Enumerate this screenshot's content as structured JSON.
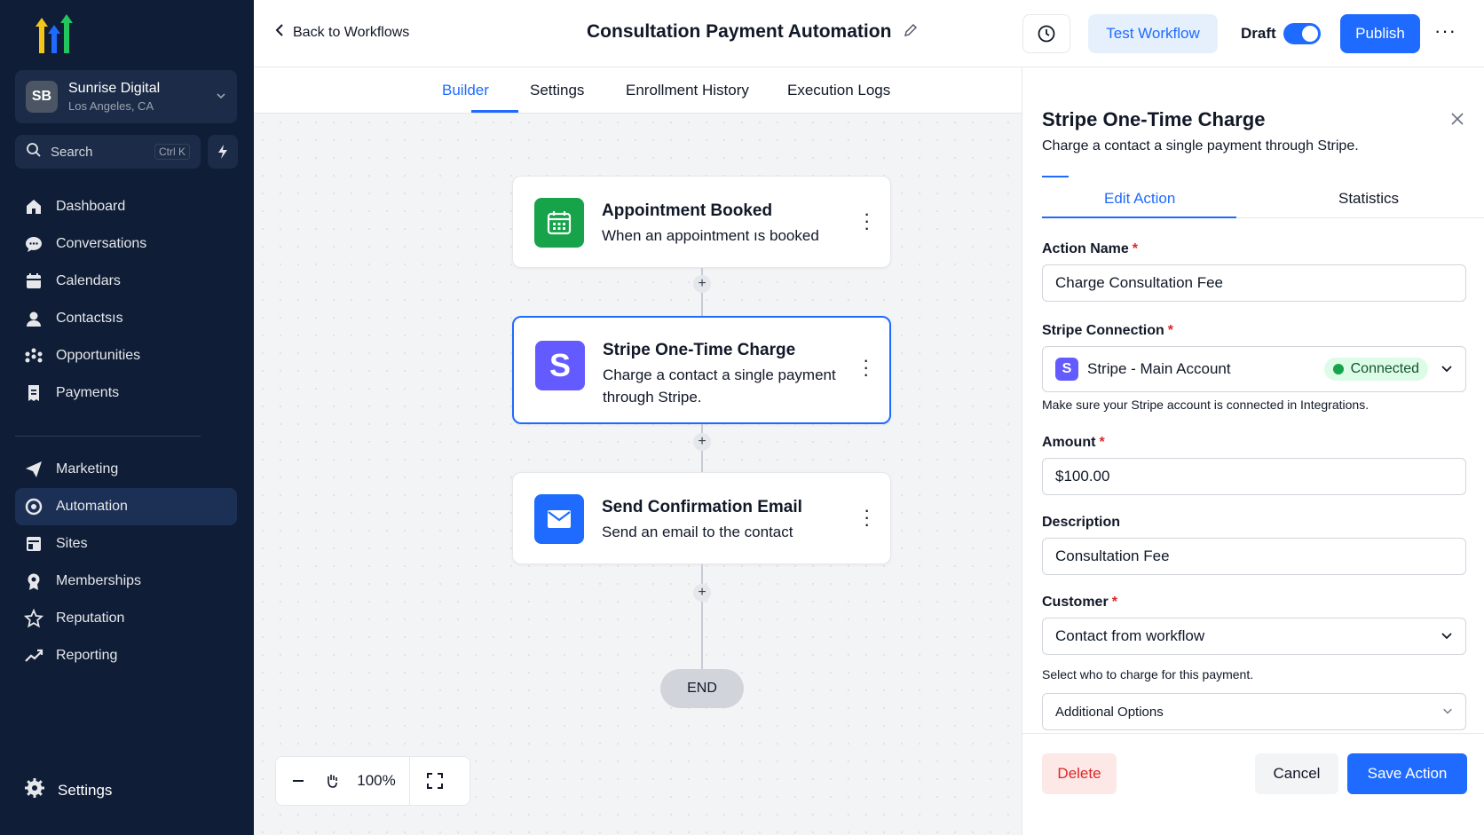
{
  "sidebar": {
    "account": {
      "initials": "SB",
      "name": "Sunrise Digital",
      "location": "Los Angeles, CA"
    },
    "search": {
      "label": "Search",
      "shortcut": "Ctrl K"
    },
    "items": [
      {
        "label": "Dashboard",
        "icon": "home-icon"
      },
      {
        "label": "Conversations",
        "icon": "chat-icon"
      },
      {
        "label": "Calendars",
        "icon": "calendar-icon"
      },
      {
        "label": "Contactsıs",
        "icon": "contacts-icon"
      },
      {
        "label": "Opportunities",
        "icon": "opportunities-icon"
      },
      {
        "label": "Payments",
        "icon": "payments-icon"
      }
    ],
    "items2": [
      {
        "label": "Marketing",
        "icon": "send-icon"
      },
      {
        "label": "Automation",
        "icon": "automation-icon",
        "active": true
      },
      {
        "label": "Sites",
        "icon": "sites-icon"
      },
      {
        "label": "Memberships",
        "icon": "membership-icon"
      },
      {
        "label": "Reputation",
        "icon": "star-icon"
      },
      {
        "label": "Reporting",
        "icon": "chart-icon"
      }
    ],
    "settings_label": "Settings"
  },
  "topbar": {
    "back_label": "Back to Workflows",
    "title": "Consultation Payment Automation",
    "test_label": "Test Workflow",
    "draft_label": "Draft",
    "draft_on": true,
    "publish_label": "Publish"
  },
  "tabs": [
    "Builder",
    "Settings",
    "Enrollment History",
    "Execution Logs"
  ],
  "canvas": {
    "nodes": [
      {
        "title": "Appointment Booked",
        "desc": "When an appointment ıs booked"
      },
      {
        "title": "Stripe One-Time Charge",
        "desc": "Charge a contact a single payment through Stripe."
      },
      {
        "title": "Send Confirmation Email",
        "desc": "Send an email to the contact"
      }
    ],
    "end_label": "END",
    "zoom_label": "100%"
  },
  "panel": {
    "title": "Stripe One-Time Charge",
    "subtitle": "Charge a contact a single payment through Stripe.",
    "tabs": [
      "Edit Action",
      "Statistics"
    ],
    "action_name_label": "Action Name",
    "action_name_value": "Charge Consultation Fee",
    "connection_label": "Stripe Connection",
    "connection_value": "Stripe - Main Account",
    "connection_status": "Connected",
    "connection_hint": "Make sure your Stripe account is connected in Integrations.",
    "amount_label": "Amount",
    "amount_value": "$100.00",
    "description_label": "Description",
    "description_value": "Consultation Fee",
    "customer_label": "Customer",
    "customer_value": "Contact from workflow",
    "customer_hint": "Select who to charge for this payment.",
    "additional_label": "Additional Options",
    "delete_label": "Delete",
    "cancel_label": "Cancel",
    "save_label": "Save Action"
  },
  "colors": {
    "accent": "#1f6bff",
    "sidebar_bg": "#0f1d36",
    "success": "#16a34a",
    "danger": "#dc2626"
  }
}
